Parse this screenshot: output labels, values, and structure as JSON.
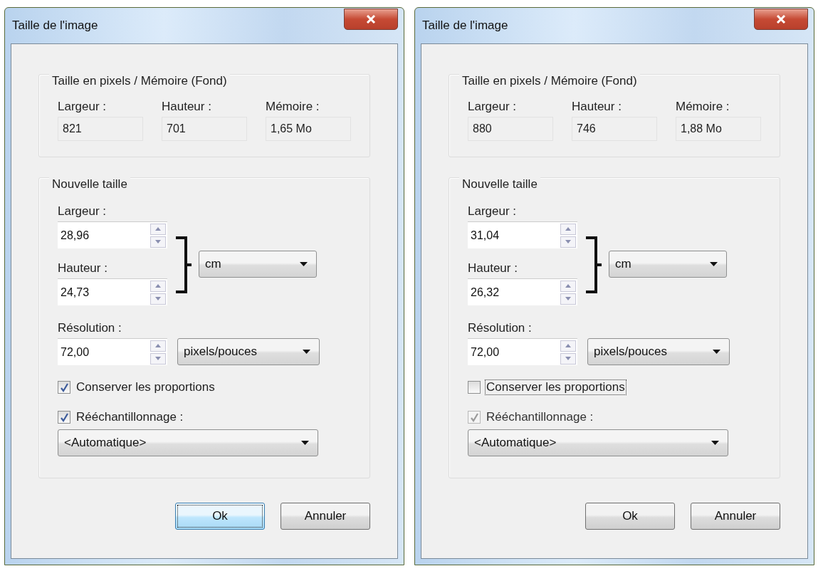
{
  "dialogs": [
    {
      "title": "Taille de l'image",
      "pixel_group": {
        "title": "Taille en pixels / Mémoire (Fond)",
        "fields": [
          {
            "label": "Largeur :",
            "value": "821"
          },
          {
            "label": "Hauteur :",
            "value": "701"
          },
          {
            "label": "Mémoire :",
            "value": "1,65 Mo"
          }
        ]
      },
      "new_size": {
        "title": "Nouvelle taille",
        "width": {
          "label": "Largeur :",
          "value": "28,96"
        },
        "height": {
          "label": "Hauteur :",
          "value": "24,73"
        },
        "unit": "cm",
        "resolution": {
          "label": "Résolution :",
          "value": "72,00"
        },
        "resolution_unit": "pixels/pouces",
        "keep_proportions": {
          "label": "Conserver les proportions",
          "checked": true,
          "disabled": false,
          "focused": false
        },
        "resample": {
          "label": "Rééchantillonnage :",
          "checked": true,
          "disabled": false,
          "focused": false
        },
        "resample_method": "<Automatique>"
      },
      "buttons": [
        {
          "label": "Ok",
          "focused": true
        },
        {
          "label": "Annuler",
          "focused": false
        }
      ]
    },
    {
      "title": "Taille de l'image",
      "pixel_group": {
        "title": "Taille en pixels / Mémoire (Fond)",
        "fields": [
          {
            "label": "Largeur :",
            "value": "880"
          },
          {
            "label": "Hauteur :",
            "value": "746"
          },
          {
            "label": "Mémoire :",
            "value": "1,88 Mo"
          }
        ]
      },
      "new_size": {
        "title": "Nouvelle taille",
        "width": {
          "label": "Largeur :",
          "value": "31,04"
        },
        "height": {
          "label": "Hauteur :",
          "value": "26,32"
        },
        "unit": "cm",
        "resolution": {
          "label": "Résolution :",
          "value": "72,00"
        },
        "resolution_unit": "pixels/pouces",
        "keep_proportions": {
          "label": "Conserver les proportions",
          "checked": false,
          "disabled": false,
          "focused": true
        },
        "resample": {
          "label": "Rééchantillonnage :",
          "checked": true,
          "disabled": true,
          "focused": false
        },
        "resample_method": "<Automatique>"
      },
      "buttons": [
        {
          "label": "Ok",
          "focused": false
        },
        {
          "label": "Annuler",
          "focused": false
        }
      ]
    }
  ]
}
